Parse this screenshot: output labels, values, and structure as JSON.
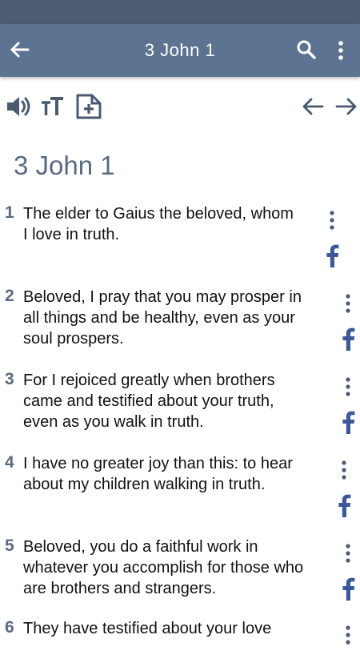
{
  "app_bar": {
    "title": "3 John 1"
  },
  "chapter_heading": "3 John 1",
  "verses": [
    {
      "number": "1",
      "lines": [
        "The elder to Gaius the beloved, whom",
        "I love in truth."
      ]
    },
    {
      "number": "2",
      "lines": [
        "Beloved, I pray that you may prosper in",
        "all things and be healthy, even as your",
        "soul prospers."
      ]
    },
    {
      "number": "3",
      "lines": [
        "For I rejoiced greatly when brothers",
        "came and testified about your truth,",
        "even as you walk in truth."
      ]
    },
    {
      "number": "4",
      "lines": [
        "I have no greater joy than this: to hear",
        "about my children walking in truth."
      ]
    },
    {
      "number": "5",
      "lines": [
        "Beloved, you do a faithful work in",
        "whatever you accomplish for those who",
        "are brothers and strangers."
      ]
    },
    {
      "number": "6",
      "lines": [
        "They have testified about your love"
      ]
    }
  ],
  "icons": {
    "back": "arrow-left-icon",
    "search": "search-icon",
    "more": "more-vertical-icon",
    "audio": "volume-icon",
    "text_size": "text-size-icon",
    "add_note": "add-note-icon",
    "prev": "arrow-left-icon",
    "next": "arrow-right-icon",
    "verse_menu": "more-vertical-icon",
    "share": "facebook-icon"
  },
  "colors": {
    "app_bar": "#5d7392",
    "status_bar": "#4d5c72",
    "accent": "#5a6a80",
    "facebook": "#3b5998"
  }
}
